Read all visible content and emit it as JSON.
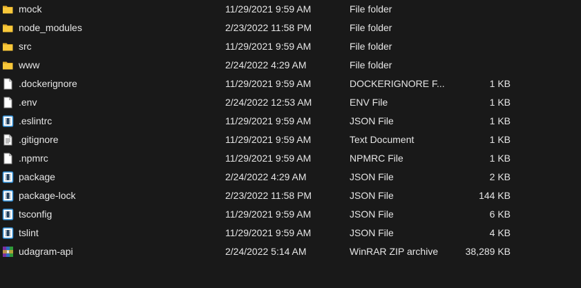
{
  "files": [
    {
      "name": "mock",
      "date": "11/29/2021 9:59 AM",
      "type": "File folder",
      "size": "",
      "icon": "folder-icon"
    },
    {
      "name": "node_modules",
      "date": "2/23/2022 11:58 PM",
      "type": "File folder",
      "size": "",
      "icon": "folder-icon"
    },
    {
      "name": "src",
      "date": "11/29/2021 9:59 AM",
      "type": "File folder",
      "size": "",
      "icon": "folder-icon"
    },
    {
      "name": "www",
      "date": "2/24/2022 4:29 AM",
      "type": "File folder",
      "size": "",
      "icon": "folder-icon"
    },
    {
      "name": ".dockerignore",
      "date": "11/29/2021 9:59 AM",
      "type": "DOCKERIGNORE F...",
      "size": "1 KB",
      "icon": "blank-file-icon"
    },
    {
      "name": ".env",
      "date": "2/24/2022 12:53 AM",
      "type": "ENV File",
      "size": "1 KB",
      "icon": "blank-file-icon"
    },
    {
      "name": ".eslintrc",
      "date": "11/29/2021 9:59 AM",
      "type": "JSON File",
      "size": "1 KB",
      "icon": "json-file-icon"
    },
    {
      "name": ".gitignore",
      "date": "11/29/2021 9:59 AM",
      "type": "Text Document",
      "size": "1 KB",
      "icon": "text-file-icon"
    },
    {
      "name": ".npmrc",
      "date": "11/29/2021 9:59 AM",
      "type": "NPMRC File",
      "size": "1 KB",
      "icon": "blank-file-icon"
    },
    {
      "name": "package",
      "date": "2/24/2022 4:29 AM",
      "type": "JSON File",
      "size": "2 KB",
      "icon": "json-file-icon"
    },
    {
      "name": "package-lock",
      "date": "2/23/2022 11:58 PM",
      "type": "JSON File",
      "size": "144 KB",
      "icon": "json-file-icon"
    },
    {
      "name": "tsconfig",
      "date": "11/29/2021 9:59 AM",
      "type": "JSON File",
      "size": "6 KB",
      "icon": "json-file-icon"
    },
    {
      "name": "tslint",
      "date": "11/29/2021 9:59 AM",
      "type": "JSON File",
      "size": "4 KB",
      "icon": "json-file-icon"
    },
    {
      "name": "udagram-api",
      "date": "2/24/2022 5:14 AM",
      "type": "WinRAR ZIP archive",
      "size": "38,289 KB",
      "icon": "winrar-archive-icon"
    }
  ],
  "colors": {
    "background": "#191919",
    "text": "#e6e6e6",
    "folder": "#f8c83a",
    "json_accent": "#2f8fd8"
  }
}
